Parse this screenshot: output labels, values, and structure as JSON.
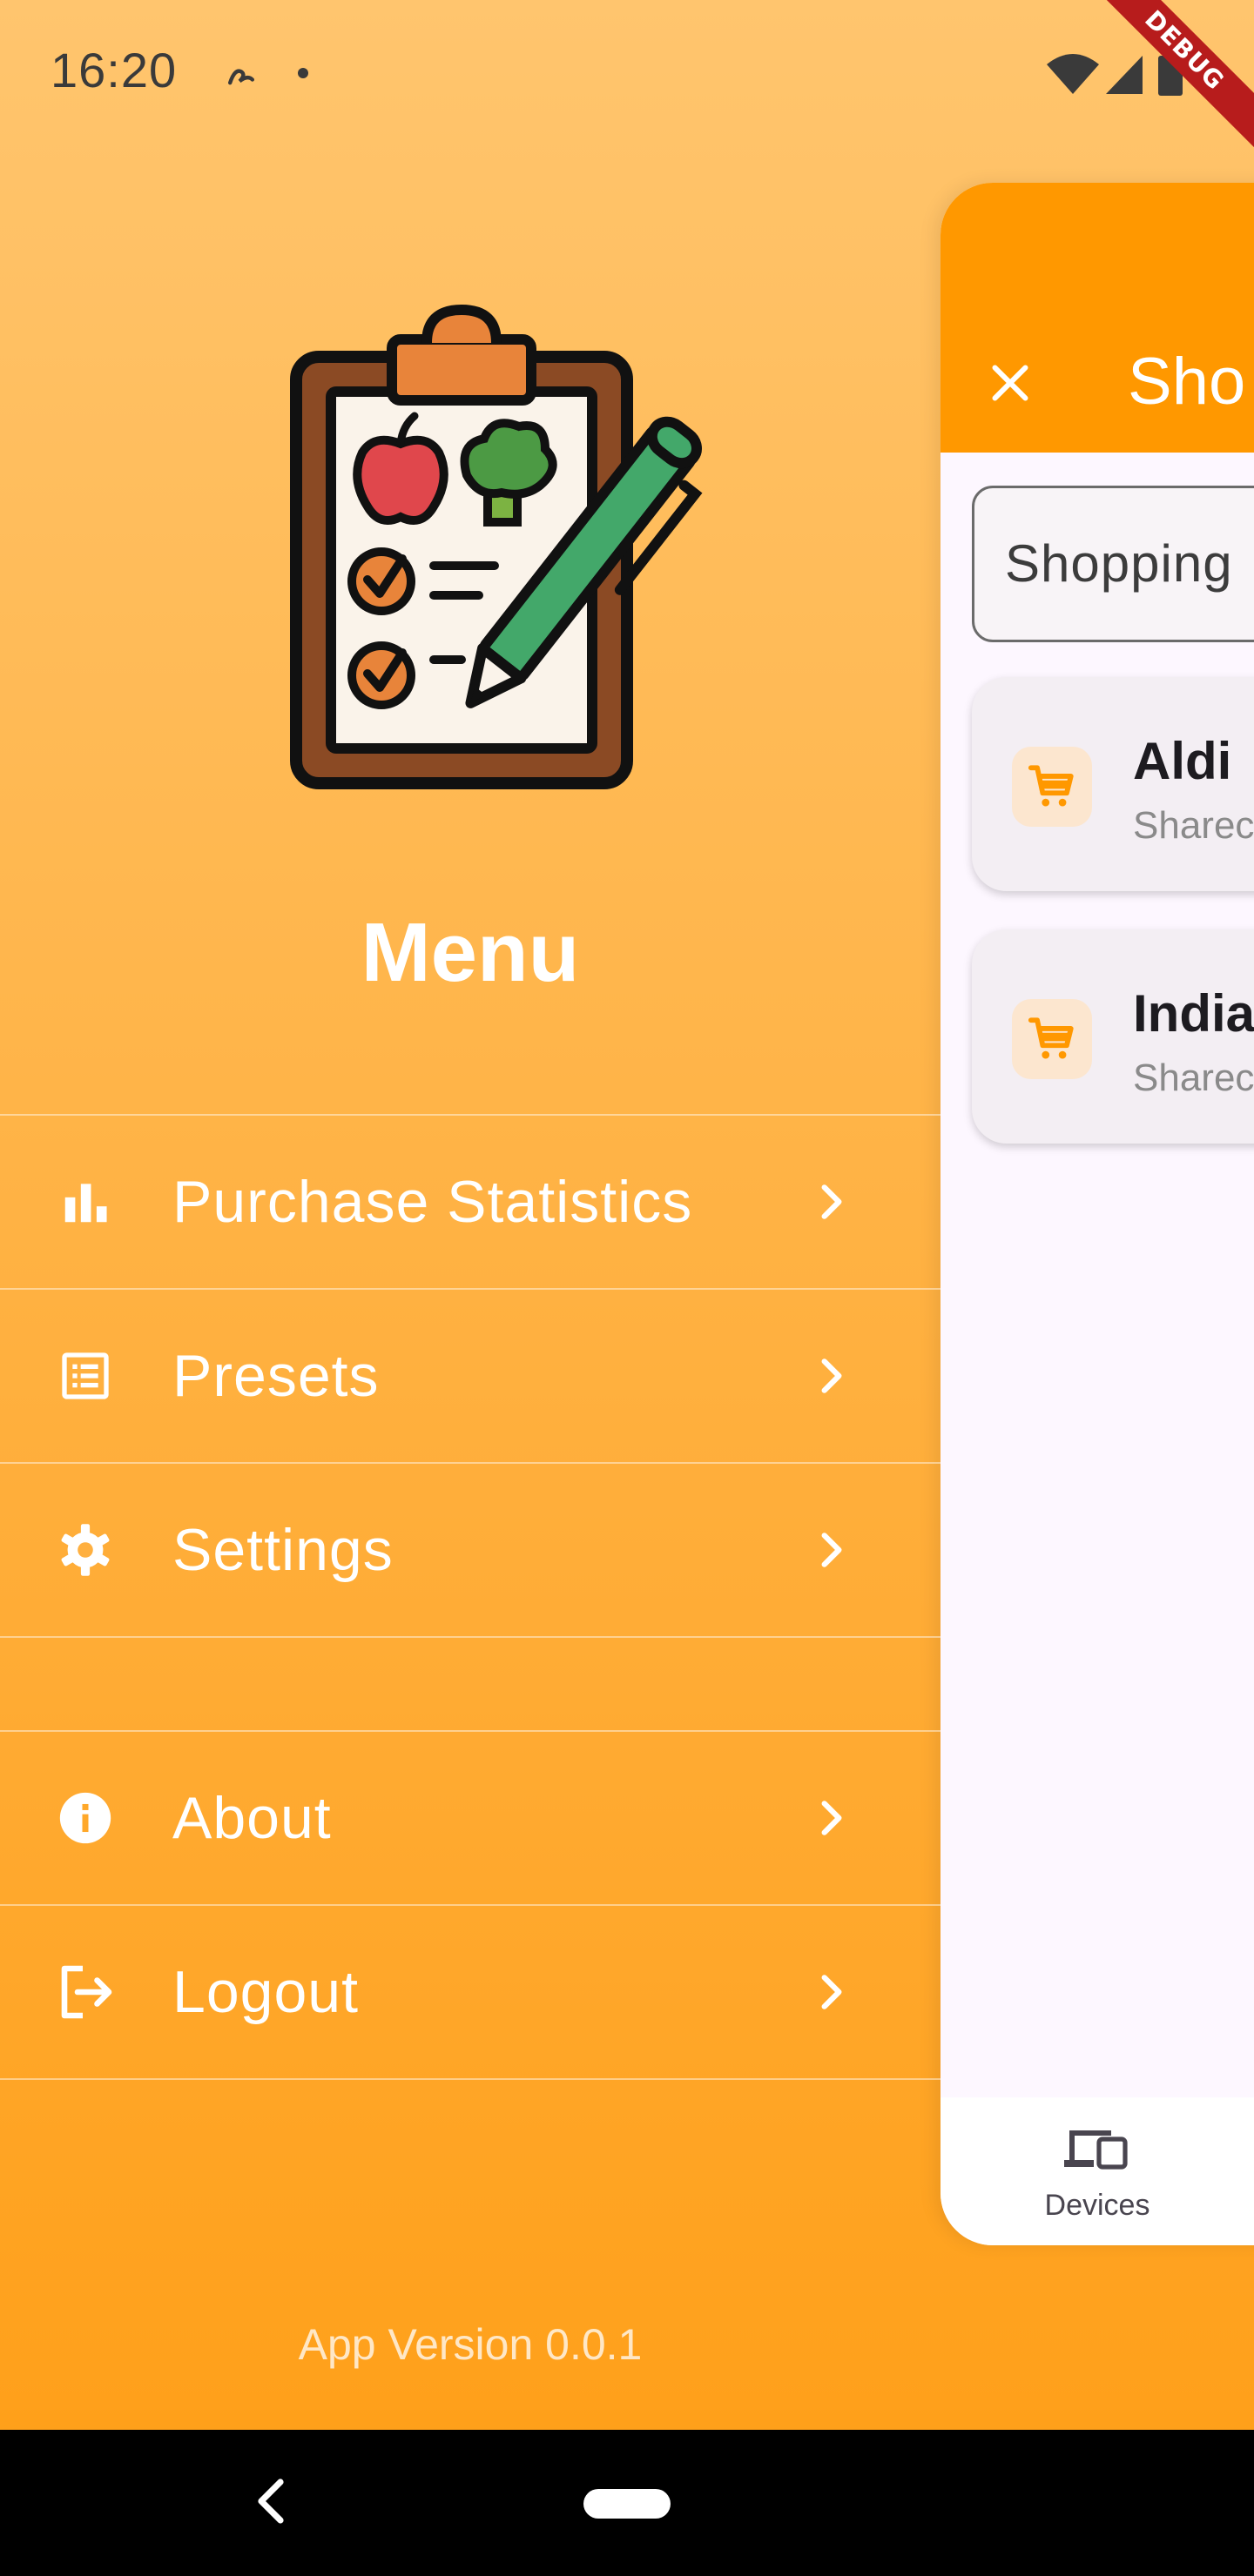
{
  "status_bar": {
    "time": "16:20",
    "debug_label": "DEBUG"
  },
  "drawer": {
    "title": "Menu",
    "items": [
      {
        "label": "Purchase Statistics",
        "icon": "bar-chart-icon"
      },
      {
        "label": "Presets",
        "icon": "list-icon"
      },
      {
        "label": "Settings",
        "icon": "gear-icon"
      },
      {
        "label": "About",
        "icon": "info-icon"
      },
      {
        "label": "Logout",
        "icon": "logout-icon"
      }
    ],
    "app_version": "App Version 0.0.1"
  },
  "page": {
    "title": "Sho",
    "search_text": "Shopping",
    "lists": [
      {
        "name": "Aldi",
        "subtitle": "Sharec"
      },
      {
        "name": "India",
        "subtitle": "Sharec"
      }
    ],
    "bottom_nav": {
      "label": "Devices"
    }
  },
  "colors": {
    "accent": "#FF9800",
    "gradient_top": "#FFC56E",
    "gradient_bottom": "#FFA01A"
  }
}
